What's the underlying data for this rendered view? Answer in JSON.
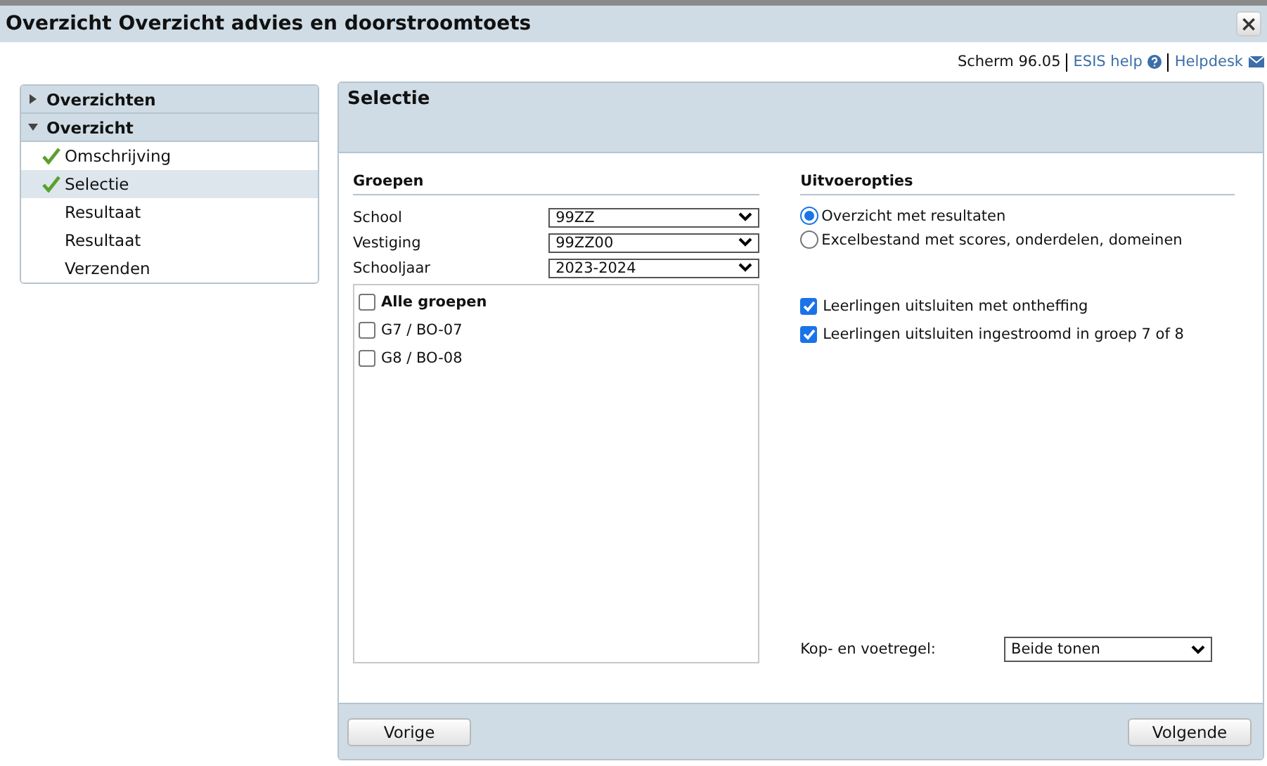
{
  "window": {
    "title": "Overzicht Overzicht advies en doorstroomtoets",
    "close": "×"
  },
  "header_links": {
    "screen": "Scherm 96.05",
    "help": "ESIS help",
    "helpdesk": "Helpdesk"
  },
  "nav": {
    "sections": [
      {
        "label": "Overzichten",
        "expanded": false
      },
      {
        "label": "Overzicht",
        "expanded": true,
        "items": [
          {
            "label": "Omschrijving",
            "done": true,
            "selected": false
          },
          {
            "label": "Selectie",
            "done": true,
            "selected": true
          },
          {
            "label": "Resultaat",
            "done": false,
            "selected": false
          },
          {
            "label": "Resultaat",
            "done": false,
            "selected": false
          },
          {
            "label": "Verzenden",
            "done": false,
            "selected": false
          }
        ]
      }
    ]
  },
  "panel": {
    "title": "Selectie",
    "groups": {
      "heading": "Groepen",
      "fields": [
        {
          "label": "School",
          "value": "99ZZ"
        },
        {
          "label": "Vestiging",
          "value": "99ZZ00"
        },
        {
          "label": "Schooljaar",
          "value": "2023-2024"
        }
      ],
      "list": [
        {
          "label": "Alle groepen",
          "kind": "all",
          "checked": false
        },
        {
          "label": "G7 / BO-07",
          "kind": "group",
          "checked": false
        },
        {
          "label": "G8 / BO-08",
          "kind": "group",
          "checked": false
        }
      ]
    },
    "options": {
      "heading": "Uitvoeropties",
      "radios": [
        {
          "label": "Overzicht met resultaten",
          "selected": true
        },
        {
          "label": "Excelbestand met scores, onderdelen, domeinen",
          "selected": false
        }
      ],
      "checkboxes": [
        {
          "label": "Leerlingen uitsluiten met ontheffing",
          "checked": true
        },
        {
          "label": "Leerlingen uitsluiten ingestroomd in groep 7 of 8",
          "checked": true
        }
      ],
      "header_footer": {
        "label": "Kop- en voetregel:",
        "value": "Beide tonen"
      }
    },
    "buttons": {
      "previous": "Vorige",
      "next": "Volgende"
    }
  }
}
